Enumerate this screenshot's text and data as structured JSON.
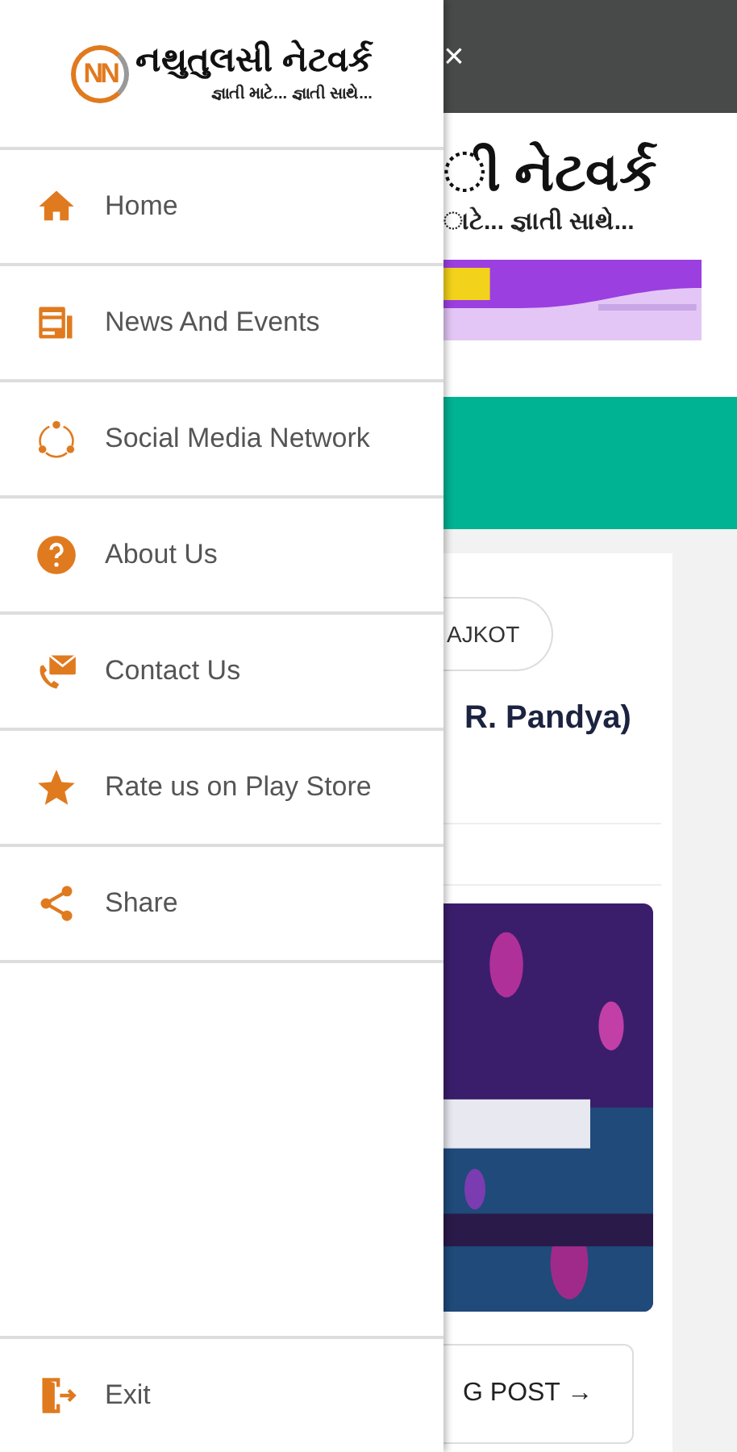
{
  "drawer": {
    "logo_mark": "NN",
    "title": "નથુતુલસી નેટવર્ક",
    "subtitle": "જ્ઞાતી માટે... જ્ઞાતી સાથે...",
    "items": [
      {
        "kind": "home",
        "label": "Home"
      },
      {
        "kind": "news",
        "label": "News And Events"
      },
      {
        "kind": "social",
        "label": "Social Media Network"
      },
      {
        "kind": "about",
        "label": "About Us"
      },
      {
        "kind": "contact",
        "label": "Contact Us"
      },
      {
        "kind": "rate",
        "label": "Rate us on Play Store"
      },
      {
        "kind": "share",
        "label": "Share"
      }
    ],
    "exit": {
      "kind": "exit",
      "label": "Exit"
    }
  },
  "background": {
    "close_glyph": "×",
    "site_title": "ી નેટવર્ક",
    "site_subtitle": "ાટે... જ્ઞાતી સાથે...",
    "chip": "AJKOT",
    "post_title": "R. Pandya)",
    "button": "G POST →"
  }
}
